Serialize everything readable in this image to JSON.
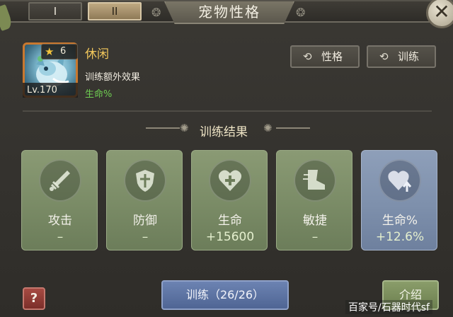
{
  "tabs": [
    {
      "label": "I",
      "active": false
    },
    {
      "label": "II",
      "active": true
    }
  ],
  "window_title": "宠物性格",
  "pet": {
    "name": "休闲",
    "stars": "6",
    "level_text": "Lv.170",
    "bonus_label": "训练额外效果",
    "bonus_value": "生命%"
  },
  "buttons": {
    "personality": "性格",
    "train_top": "训练",
    "help": "?",
    "train_main": "训练（26/26）",
    "intro": "介绍"
  },
  "section_title": "训练结果",
  "stats": [
    {
      "icon": "sword-icon",
      "label": "攻击",
      "value": "–",
      "color": "#8a9a74"
    },
    {
      "icon": "shield-icon",
      "label": "防御",
      "value": "–",
      "color": "#8a9a74"
    },
    {
      "icon": "heart-plus-icon",
      "label": "生命",
      "value": "+15600",
      "color": "#8a9a74"
    },
    {
      "icon": "boot-icon",
      "label": "敏捷",
      "value": "–",
      "color": "#8a9a74"
    },
    {
      "icon": "heart-up-icon",
      "label": "生命%",
      "value": "+12.6%",
      "color": "#8e9fb9"
    }
  ],
  "watermark": "百家号/石器时代sf",
  "colors": {
    "accent_gold": "#f3c85c",
    "bonus_green": "#6fce52",
    "train_blue": "#5a70a0",
    "help_red": "#9a423b"
  }
}
